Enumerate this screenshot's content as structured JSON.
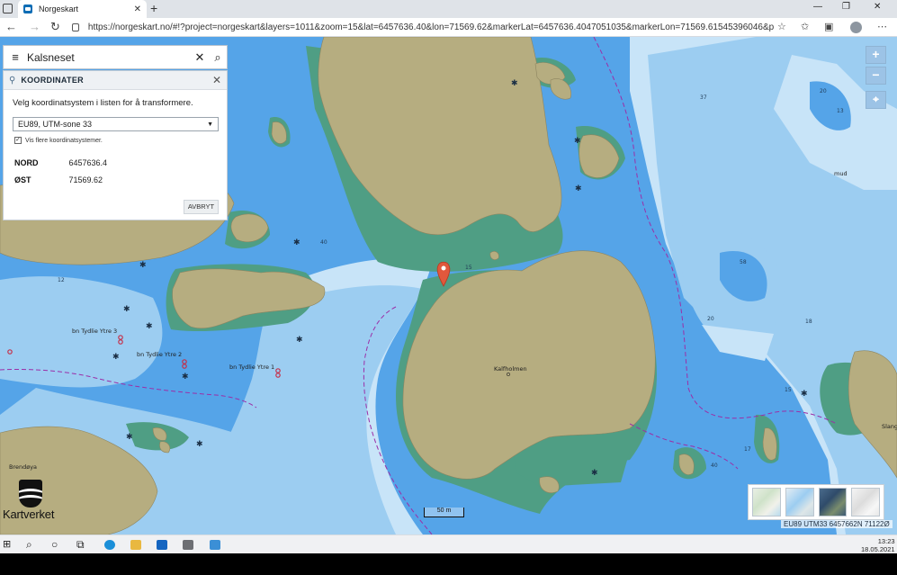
{
  "browser": {
    "tab_title": "Norgeskart",
    "tab_close": "✕",
    "new_tab": "+",
    "url": "https://norgeskart.no/#!?project=norgeskart&layers=1011&zoom=15&lat=6457636.40&lon=71569.62&markerLat=6457636.4047051035&markerLon=71569.61545396046&pa...",
    "window_minimize": "—",
    "window_maximize": "❐",
    "window_close": "✕",
    "back": "←",
    "forward": "→",
    "reload": "↻"
  },
  "search": {
    "menu_glyph": "≡",
    "query": "Kalsneset",
    "clear_glyph": "✕",
    "search_glyph": "⌕"
  },
  "coord_panel": {
    "title": "KOORDINATER",
    "close_glyph": "✕",
    "intro": "Velg koordinatsystem i listen for å transformere.",
    "selected_system": "EU89, UTM-sone 33",
    "show_more_label": "Vis flere koordinatsystemer.",
    "show_more_checked": true,
    "rows": [
      {
        "label": "NORD",
        "value": "6457636.4"
      },
      {
        "label": "ØST",
        "value": "71569.62"
      }
    ],
    "cancel_label": "AVBRYT"
  },
  "map": {
    "zoom_in": "+",
    "zoom_out": "−",
    "locate": "⌖",
    "scale_label": "50 m",
    "coord_readout": "EU89 UTM33 6457662N 71122Ø",
    "logo_text": "Kartverket",
    "place_names": [
      "Kalfholmen",
      "bn Tydlie Ytre 3",
      "bn Tydlie Ytre 2",
      "bn Tydlie Ytre 1",
      "Brendøya",
      "Slang",
      "mud"
    ],
    "depth_soundings": [
      "37",
      "20",
      "13",
      "12",
      "40",
      "15",
      "58",
      "18",
      "20",
      "17",
      "40",
      "15"
    ],
    "colors": {
      "deep_water": "#c8e4f8",
      "mid_water": "#9ccdf1",
      "shallow_water": "#55a4e8",
      "drying_area": "#4f9e84",
      "land": "#b6ad80",
      "marker": "#e1583c",
      "boundary": "#9b2fa8"
    }
  },
  "taskbar": {
    "time": "13:23",
    "date": "18.05.2021"
  }
}
